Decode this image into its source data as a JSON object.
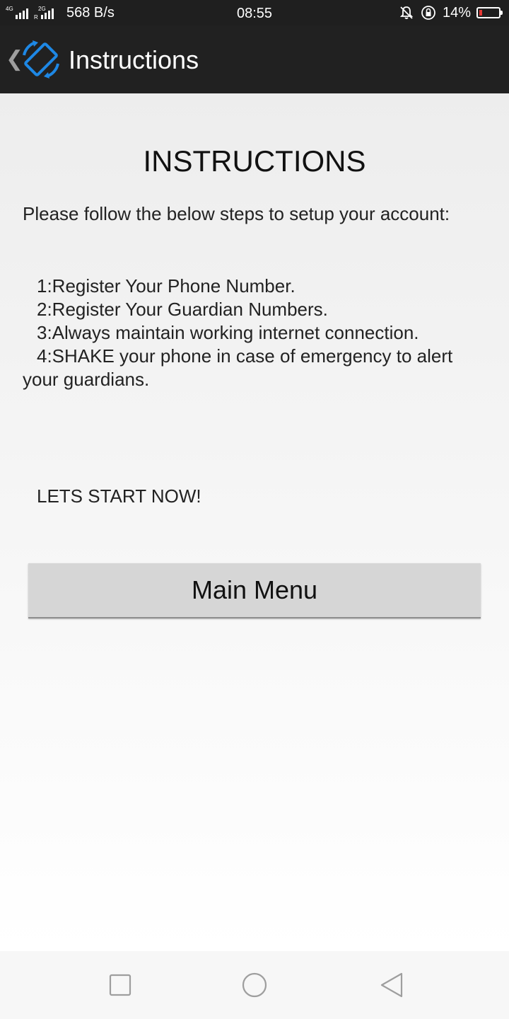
{
  "status_bar": {
    "signal_1": "4G",
    "signal_2": "2G",
    "network_speed": "568 B/s",
    "time": "08:55",
    "battery_percent": "14%",
    "battery_level": 0.14,
    "icons": [
      "signal-icon",
      "mute-icon",
      "rotation-lock-icon",
      "battery-icon"
    ]
  },
  "app_bar": {
    "title": "Instructions",
    "logo_icon": "screen-rotation-icon",
    "accent": "#1e88e5"
  },
  "main": {
    "heading": "INSTRUCTIONS",
    "intro": "Please follow the below steps to setup your account:",
    "steps": [
      "1:Register Your Phone Number.",
      "2:Register Your Guardian Numbers.",
      "3:Always maintain working internet connection.",
      "4:SHAKE your phone in case of emergency to alert your guardians."
    ],
    "start_text": "LETS START NOW!",
    "main_menu_label": "Main Menu"
  },
  "nav_bar": {
    "icons": [
      "recent-apps-icon",
      "home-icon",
      "back-icon"
    ]
  }
}
